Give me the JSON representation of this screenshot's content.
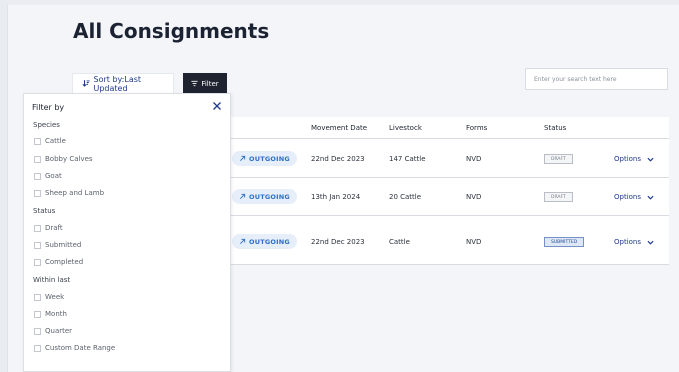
{
  "page": {
    "title": "All Consignments"
  },
  "toolbar": {
    "sort_label": "Sort by:Last Updated",
    "filter_label": "Filter",
    "search_placeholder": "Enter your search text here"
  },
  "table": {
    "columns": [
      "Movement Date",
      "Livestock",
      "Forms",
      "Status"
    ],
    "rows": [
      {
        "direction": "OUTGOING",
        "movement_date": "22nd Dec 2023",
        "livestock": "147 Cattle",
        "forms": "NVD",
        "status": "DRAFT",
        "options": "Options"
      },
      {
        "direction": "OUTGOING",
        "movement_date": "13th Jan 2024",
        "livestock": "20 Cattle",
        "forms": "NVD",
        "status": "DRAFT",
        "options": "Options"
      },
      {
        "direction": "OUTGOING",
        "movement_date": "22nd Dec 2023",
        "livestock": "Cattle",
        "forms": "NVD",
        "status": "SUBMITTED",
        "options": "Options"
      }
    ]
  },
  "filter_panel": {
    "title": "Filter by",
    "species_label": "Species",
    "species": [
      "Cattle",
      "Bobby Calves",
      "Goat",
      "Sheep and Lamb"
    ],
    "status_label": "Status",
    "status": [
      "Draft",
      "Submitted",
      "Completed"
    ],
    "within_label": "Within last",
    "within": [
      "Week",
      "Month",
      "Quarter",
      "Custom Date Range"
    ]
  },
  "colors": {
    "accent": "#1f3a8a",
    "outgoing_bg": "#e6eef9",
    "outgoing_text": "#2d6fc4",
    "dark_button": "#1f2330"
  }
}
